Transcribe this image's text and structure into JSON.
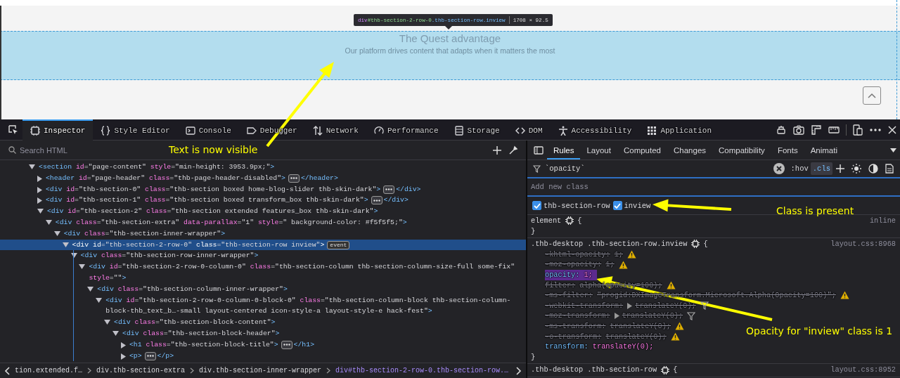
{
  "viewport": {
    "heading": "The Quest advantage",
    "subheading": "Our platform drives content that adapts when it matters the most",
    "tooltip": {
      "selector": "div#thb-section-2-row-0.thb-section-row.inview",
      "size": "1708 × 92.5"
    }
  },
  "toolbar": {
    "tools": [
      {
        "label": "Inspector",
        "selected": true
      },
      {
        "label": "Style Editor",
        "selected": false
      },
      {
        "label": "Console",
        "selected": false
      },
      {
        "label": "Debugger",
        "selected": false
      },
      {
        "label": "Network",
        "selected": false
      },
      {
        "label": "Performance",
        "selected": false
      },
      {
        "label": "Storage",
        "selected": false
      },
      {
        "label": "DOM",
        "selected": false
      },
      {
        "label": "Accessibility",
        "selected": false
      },
      {
        "label": "Application",
        "selected": false
      }
    ]
  },
  "inspector": {
    "search_placeholder": "Search HTML",
    "tree": [
      {
        "text": "<section id=\"page-content\" style=\"min-height: 3953.9px;\">",
        "expanded": true,
        "selected": false,
        "children": [
          {
            "text": "<header id=\"page-header\" class=\"thb-page-header-disabled\">",
            "close": "</header>",
            "expanded": false,
            "selected": false
          },
          {
            "text": "<div id=\"thb-section-0\" class=\"thb-section boxed home-blog-slider thb-skin-dark\">",
            "close": "</div>",
            "expanded": false,
            "selected": false
          },
          {
            "text": "<div id=\"thb-section-1\" class=\"thb-section boxed transform_box thb-skin-dark\">",
            "close": "</div>",
            "expanded": false,
            "selected": false
          },
          {
            "text": "<div id=\"thb-section-2\" class=\"thb-section extended features_box thb-skin-dark\">",
            "expanded": true,
            "selected": false,
            "children": [
              {
                "text": "<div class=\"thb-section-extra\" data-parallax=\"1\" style=\" background-color: #f5f5f5;\">",
                "expanded": true,
                "selected": false,
                "children": [
                  {
                    "text": "<div class=\"thb-section-inner-wrapper\">",
                    "expanded": true,
                    "selected": false,
                    "children": [
                      {
                        "text": "<div id=\"thb-section-2-row-0\" class=\"thb-section-row inview\">",
                        "badge": "event",
                        "expanded": true,
                        "selected": true,
                        "children": [
                          {
                            "text": "<div class=\"thb-section-row-inner-wrapper\">",
                            "expanded": true,
                            "selected": false,
                            "children": [
                              {
                                "text": "<div id=\"thb-section-2-row-0-column-0\" class=\"thb-section-column thb-section-column-size-full some-fix\" style=\"\">",
                                "expanded": true,
                                "selected": false,
                                "children": [
                                  {
                                    "text": "<div class=\"thb-section-column-inner-wrapper\">",
                                    "expanded": true,
                                    "selected": false,
                                    "children": [
                                      {
                                        "text": "<div id=\"thb-section-2-row-0-column-0-block-0\" class=\"thb-section-column-block thb-section-column-block-thb_text_b…-small layout-centered icon-style-a layout-style-e hack-fest\">",
                                        "expanded": true,
                                        "selected": false,
                                        "children": [
                                          {
                                            "text": "<div class=\"thb-section-block-content\">",
                                            "expanded": true,
                                            "selected": false,
                                            "children": [
                                              {
                                                "text": "<div class=\"thb-section-block-header\">",
                                                "expanded": true,
                                                "selected": false,
                                                "children": [
                                                  {
                                                    "text": "<h1 class=\"thb-section-block-title\">",
                                                    "close": "</h1>",
                                                    "expanded": false,
                                                    "selected": false
                                                  },
                                                  {
                                                    "text": "<p>",
                                                    "close": "</p>",
                                                    "expanded": false,
                                                    "selected": false
                                                  }
                                                ]
                                              }
                                            ]
                                          }
                                        ]
                                      }
                                    ]
                                  }
                                ]
                              }
                            ]
                          }
                        ]
                      }
                    ]
                  }
                ]
              }
            ]
          }
        ]
      }
    ],
    "breadcrumbs": [
      {
        "label": "tion.extended.f…",
        "selected": false
      },
      {
        "label": "div.thb-section-extra",
        "selected": false
      },
      {
        "label": "div.thb-section-inner-wrapper",
        "selected": false
      },
      {
        "label": "div#thb-section-2-row-0.thb-section-row.…",
        "selected": true
      }
    ]
  },
  "rules_panel": {
    "tabs": [
      {
        "label": "Rules",
        "selected": true
      },
      {
        "label": "Layout",
        "selected": false
      },
      {
        "label": "Computed",
        "selected": false
      },
      {
        "label": "Changes",
        "selected": false
      },
      {
        "label": "Compatibility",
        "selected": false
      },
      {
        "label": "Fonts",
        "selected": false
      },
      {
        "label": "Animati",
        "selected": false
      }
    ],
    "filter": "`opacity`",
    "hov": ":hov",
    "cls": ".cls",
    "cls_on": true,
    "add_class_placeholder": "Add new class",
    "classes": [
      {
        "name": "thb-section-row",
        "checked": true
      },
      {
        "name": "inview",
        "checked": true
      }
    ],
    "rules": [
      {
        "selector": "element",
        "open": "{",
        "source": "inline",
        "close": "}"
      },
      {
        "selector": ".thb-desktop .thb-section-row.inview",
        "open": "{",
        "source": "layout.css:8968",
        "close": "}",
        "declarations": [
          {
            "name": "-khtml-opacity:",
            "value": "1;",
            "overridden": true,
            "warning": true,
            "highlighted": false
          },
          {
            "name": "-moz-opacity:",
            "value": "1;",
            "overridden": true,
            "warning": true,
            "highlighted": false
          },
          {
            "name": "opacity:",
            "value": "1;",
            "overridden": false,
            "highlighted": true
          },
          {
            "name": "filter:",
            "value": "alpha(opacity=100);",
            "overridden": true,
            "warning": true,
            "highlighted": false
          },
          {
            "name": "-ms-filter:",
            "value": "\"progid:DXImageTransform.Microsoft.Alpha(Opacity=100)\";",
            "overridden": true,
            "warning": true,
            "highlighted": false
          },
          {
            "name": "-webkit-transform:",
            "value": "translateY(0);",
            "overridden": true,
            "expandable": true,
            "filter_icon": true,
            "highlighted": false
          },
          {
            "name": "-moz-transform:",
            "value": "translateY(0);",
            "overridden": true,
            "expandable": true,
            "filter_icon": true,
            "highlighted": false
          },
          {
            "name": "-ms-transform:",
            "value": "translateY(0);",
            "overridden": true,
            "warning": true,
            "highlighted": false
          },
          {
            "name": "-o-transform:",
            "value": "translateY(0);",
            "overridden": true,
            "warning": true,
            "highlighted": false
          },
          {
            "name": "transform:",
            "value": "translateY(0);",
            "overridden": false,
            "highlighted": false
          }
        ]
      },
      {
        "selector": ".thb-desktop .thb-section-row",
        "open": "{",
        "source": "layout.css:8952"
      }
    ]
  },
  "annotations": [
    {
      "text": "Text is now visible"
    },
    {
      "text": "Class is present"
    },
    {
      "text": "Opacity for \"inview\" class is 1"
    }
  ]
}
